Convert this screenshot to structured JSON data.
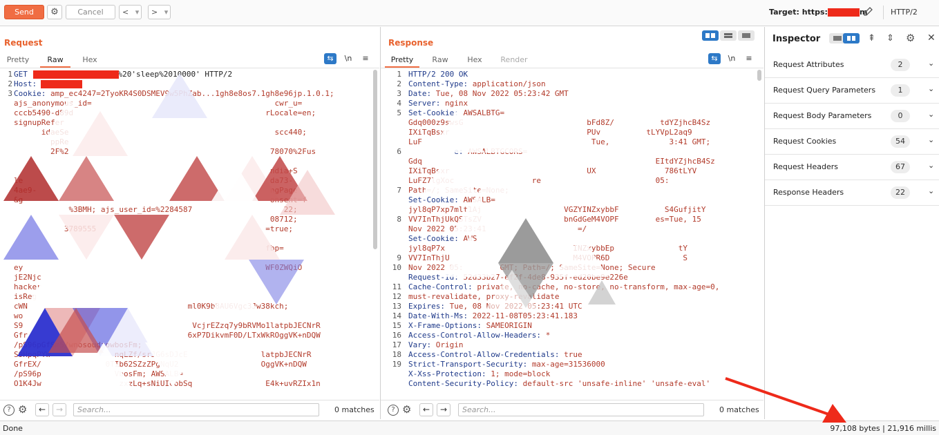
{
  "toolbar": {
    "send_label": "Send",
    "cancel_label": "Cancel",
    "back_label": "<",
    "forward_label": ">",
    "dropdown_glyph": "▾",
    "target_prefix": "Target: https:",
    "target_suffix": "m",
    "protocol": "HTTP/2",
    "accent": "#f06d43"
  },
  "request": {
    "title": "Request",
    "tabs": [
      "Pretty",
      "Raw",
      "Hex"
    ],
    "active_tab": "Raw",
    "line_numbers": [
      "1",
      "2",
      "3",
      "",
      "",
      "",
      "",
      "",
      "",
      "",
      "",
      "",
      "",
      "",
      "",
      "",
      "",
      "",
      "",
      "",
      "",
      "",
      "",
      "",
      "",
      "",
      "",
      "",
      "",
      "",
      "",
      "",
      ""
    ],
    "lines": [
      {
        "k": "GET ",
        "v": "",
        "r": "%20'sleep%2010000' HTTP/2"
      },
      {
        "k": "Host: ",
        "v": "",
        "r": ""
      },
      {
        "k": "Cookie: ",
        "v": "amp_ec4247=2TyoKR4S0DSMEV9w5PhZab...1gh8e8os7.1gh8e96jp.1.0.1;",
        "r": ""
      },
      {
        "k": "",
        "v": "ajs_anonymous_id=                                        cwr_u=",
        "r": ""
      },
      {
        "k": "",
        "v": "cccb5490-d89d                                          rLocale=en;",
        "r": ""
      },
      {
        "k": "",
        "v": "signupRefer",
        "r": ""
      },
      {
        "k": "",
        "v": "      idaeSe                                             scc440;",
        "r": ""
      },
      {
        "k": "",
        "v": "        ppRe",
        "r": ""
      },
      {
        "k": "",
        "v": "        2F%2                                            78070%2Fus",
        "r": ""
      },
      {
        "k": "",
        "v": "",
        "r": ""
      },
      {
        "k": "",
        "v": "                                                        ndia+S",
        "r": ""
      },
      {
        "k": "",
        "v": "le                                                      da73-",
        "r": ""
      },
      {
        "k": "",
        "v": "4ae9-                                                   ngPage",
        "r": ""
      },
      {
        "k": "",
        "v": "&g                                                      onsent=f",
        "r": ""
      },
      {
        "k": "",
        "v": "            %3BMH; ajs_user_id=%2284587                    22;",
        "r": ""
      },
      {
        "k": "",
        "v": "                                                        08712;",
        "r": ""
      },
      {
        "k": "",
        "v": "           3789555                                     =true;",
        "r": ""
      },
      {
        "k": "",
        "v": "",
        "r": ""
      },
      {
        "k": "",
        "v": "                                                       fbp=",
        "r": ""
      },
      {
        "k": "",
        "v": "",
        "r": ""
      },
      {
        "k": "",
        "v": "ey                                                     WF0ZWQiO",
        "r": ""
      },
      {
        "k": "",
        "v": "jE2Njc",
        "r": ""
      },
      {
        "k": "",
        "v": "hacker",
        "r": ""
      },
      {
        "k": "",
        "v": "isReg",
        "r": ""
      },
      {
        "k": "",
        "v": "cWN                                   ml0K9b8AU6Vgc3Jw38kch;",
        "r": ""
      },
      {
        "k": "",
        "v": "wo",
        "r": ""
      },
      {
        "k": "",
        "v": "S9                                     VcjrEZzq7y9bRVMo1latpbJECNrR",
        "r": ""
      },
      {
        "k": "",
        "v": "Gfr                                   6xP7DikvmF0D/LTxWkROggVK+nDQW",
        "r": ""
      },
      {
        "k": "",
        "v": "/pS96pGfSm5/wnosoudzowbosFm;",
        "r": ""
      },
      {
        "k": "",
        "v": "S9HpqPYW              nqLZf/srJG6sDJcE                latpbJECNrR",
        "r": ""
      },
      {
        "k": "",
        "v": "GfrEX/              0TIb62SZzZPgNqU2                  OggVK+nDQW",
        "r": ""
      },
      {
        "k": "",
        "v": "/pS96p                VbosFm; AWSALB=",
        "r": ""
      },
      {
        "k": "",
        "v": "O1K4Jw                 zxzLq+sNiUICobSq                E4k+uvRZIx1n",
        "r": ""
      }
    ],
    "search_placeholder": "Search...",
    "matches": "0 matches"
  },
  "response": {
    "title": "Response",
    "tabs": [
      "Pretty",
      "Raw",
      "Hex",
      "Render"
    ],
    "active_tab": "Pretty",
    "line_numbers": [
      "1",
      "2",
      "3",
      "4",
      "5",
      "",
      "",
      "",
      "6",
      "",
      "",
      "",
      "7",
      "",
      "",
      "8",
      "",
      "",
      "",
      "9",
      "10",
      "",
      "11",
      "12",
      "13",
      "14",
      "15",
      "16",
      "17",
      "18",
      "19"
    ],
    "lines": [
      {
        "k": "HTTP/2 200 OK",
        "v": ""
      },
      {
        "k": "Content-Type: ",
        "v": "application/json"
      },
      {
        "k": "Date: ",
        "v": "Tue, 08 Nov 2022 05:23:42 GMT"
      },
      {
        "k": "Server: ",
        "v": "nginx"
      },
      {
        "k": "Set-Cookie: ",
        "v": "AWSALBTG="
      },
      {
        "k": "",
        "v": "Gdq000z9swsG                           bFd8Z/          tdYZjhcB4Sz"
      },
      {
        "k": "",
        "v": "IXiTqBsxr                              PUv          tLYVpL2aq9"
      },
      {
        "k": "",
        "v": "LuF                                     Tue,             3:41 GMT;"
      },
      {
        "k": "          e: ",
        "v": "AWSALBTGCORS="
      },
      {
        "k": "",
        "v": "Gdq                                                   EItdYZjhcB4Sz"
      },
      {
        "k": "",
        "v": "IXiTqBsxr                              UX               786tLYV"
      },
      {
        "k": "",
        "v": "LuFZ7lgXoc                 re                         05:"
      },
      {
        "k": "",
        "v": "Path=/; SameSite=None;"
      },
      {
        "k": "Set-Cookie: ",
        "v": "AWSALB="
      },
      {
        "k": "",
        "v": "jyl8qP7xp7mlt1Aj                  VGZYINZxybbF          S4GufjitY"
      },
      {
        "k": "",
        "v": "VV7InThjUkQSTsZV                  bnGdGeM4VOPF        es=Tue, 15"
      },
      {
        "k": "",
        "v": "Nov 2022 05:23:41                    =/"
      },
      {
        "k": "Set-Cookie: ",
        "v": "AWS"
      },
      {
        "k": "",
        "v": "jyl8qP7x                            INZxybbEp              tY"
      },
      {
        "k": "",
        "v": "VV7InThjU                           M4VOPR6D                S"
      },
      {
        "k": "",
        "v": "Nov 2022 05:        GMT; Path=/; SameSite=None; Secure"
      },
      {
        "k": "Request-Id: ",
        "v": "52d33b27-ef2f-4de8-935f-ed20be9e226e"
      },
      {
        "k": "Cache-Control: ",
        "v": "private, no-cache, no-store, no-transform, max-age=0,"
      },
      {
        "k": "",
        "v": "must-revalidate, proxy-revalidate"
      },
      {
        "k": "Expires: ",
        "v": "Tue, 08 Nov 2022 05:23:41 UTC"
      },
      {
        "k": "Date-With-Ms: ",
        "v": "2022-11-08T05:23:41.183"
      },
      {
        "k": "X-Frame-Options: ",
        "v": "SAMEORIGIN"
      },
      {
        "k": "Access-Control-Allow-Headers: ",
        "v": "*"
      },
      {
        "k": "Vary: ",
        "v": "Origin"
      },
      {
        "k": "Access-Control-Allow-Credentials: ",
        "v": "true"
      },
      {
        "k": "Strict-Transport-Security: ",
        "v": "max-age=31536000"
      },
      {
        "k": "X-Xss-Protection: ",
        "v": "1; mode=block"
      },
      {
        "k": "Content-Security-Policy: ",
        "v": "default-src 'unsafe-inline' 'unsafe-eval'"
      }
    ],
    "search_placeholder": "Search...",
    "matches": "0 matches"
  },
  "inspector": {
    "title": "Inspector",
    "rows": [
      {
        "label": "Request Attributes",
        "count": "2"
      },
      {
        "label": "Request Query Parameters",
        "count": "1"
      },
      {
        "label": "Request Body Parameters",
        "count": "0"
      },
      {
        "label": "Request Cookies",
        "count": "54"
      },
      {
        "label": "Request Headers",
        "count": "67"
      },
      {
        "label": "Response Headers",
        "count": "22"
      }
    ]
  },
  "status": {
    "left": "Done",
    "right": "97,108 bytes | 21,916 millis"
  },
  "icons": {
    "settings": "gear-icon",
    "help": "help-icon",
    "edit": "pencil-icon",
    "chevron": "chevron-down-icon",
    "close": "close-icon",
    "wrap": "wrap-icon",
    "newline": "newline-icon",
    "menu": "hamburger-icon",
    "annotation_arrow": "red-arrow"
  },
  "colors": {
    "accent": "#f06d43",
    "redaction": "#ee2a1a",
    "selected_blue": "#2d79c7",
    "header_key": "#1f3a8a",
    "header_value": "#b23a2a"
  }
}
